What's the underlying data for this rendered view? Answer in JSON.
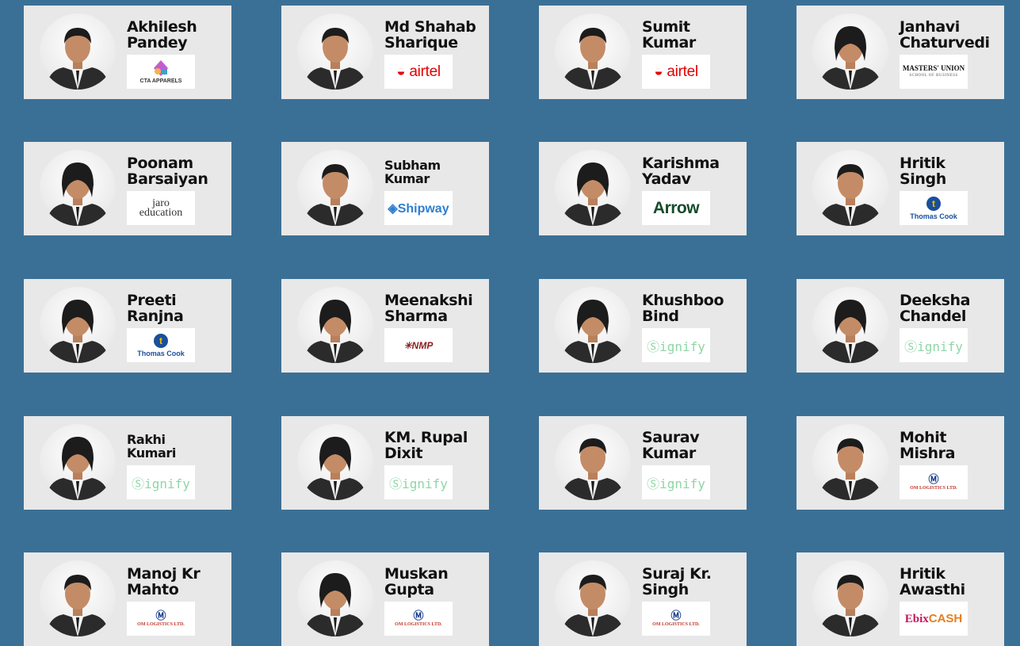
{
  "theme": {
    "background": "#3b7096",
    "card": "#e8e8e8"
  },
  "placements": [
    {
      "name": [
        "Akhilesh",
        "Pandey"
      ],
      "logo": "cta-apparels-logo",
      "logo_text": "CTA APPARELS",
      "gender": "m"
    },
    {
      "name": [
        "Md Shahab",
        "Sharique"
      ],
      "logo": "airtel-logo",
      "logo_text": "airtel",
      "gender": "m"
    },
    {
      "name": [
        "Sumit",
        "Kumar"
      ],
      "logo": "airtel-logo",
      "logo_text": "airtel",
      "gender": "m"
    },
    {
      "name": [
        "Janhavi",
        "Chaturvedi"
      ],
      "logo": "masters-union-logo",
      "logo_text": "MASTERS' UNION",
      "logo_sub": "SCHOOL OF BUSINESS",
      "gender": "f"
    },
    {
      "name": [
        "Poonam",
        "Barsaiyan"
      ],
      "logo": "jaro-education-logo",
      "logo_text": "jaro",
      "logo_sub": "education",
      "gender": "f"
    },
    {
      "name": [
        "Subham",
        "Kumar"
      ],
      "logo": "shipway-logo",
      "logo_text": "Shipway",
      "gender": "m",
      "small": true
    },
    {
      "name": [
        "Karishma",
        "Yadav"
      ],
      "logo": "arrow-logo",
      "logo_text": "Arrow",
      "gender": "f"
    },
    {
      "name": [
        "Hritik",
        "Singh"
      ],
      "logo": "thomas-cook-logo",
      "logo_text": "Thomas Cook",
      "gender": "m"
    },
    {
      "name": [
        "Preeti",
        "Ranjna"
      ],
      "logo": "thomas-cook-logo",
      "logo_text": "Thomas Cook",
      "gender": "f"
    },
    {
      "name": [
        "Meenakshi",
        "Sharma"
      ],
      "logo": "nmp-logo",
      "logo_text": "NMP",
      "gender": "f"
    },
    {
      "name": [
        "Khushboo",
        "Bind"
      ],
      "logo": "signify-logo",
      "logo_text": "Signify",
      "gender": "f"
    },
    {
      "name": [
        "Deeksha",
        "Chandel"
      ],
      "logo": "signify-logo",
      "logo_text": "Signify",
      "gender": "f"
    },
    {
      "name": [
        "Rakhi",
        "Kumari"
      ],
      "logo": "signify-logo",
      "logo_text": "Signify",
      "gender": "f",
      "small": true
    },
    {
      "name": [
        "KM. Rupal",
        "Dixit"
      ],
      "logo": "signify-logo",
      "logo_text": "Signify",
      "gender": "f"
    },
    {
      "name": [
        "Saurav",
        "Kumar"
      ],
      "logo": "signify-logo",
      "logo_text": "Signify",
      "gender": "m"
    },
    {
      "name": [
        "Mohit",
        "Mishra"
      ],
      "logo": "om-logistics-logo",
      "logo_text": "OM LOGISTICS LTD.",
      "gender": "m"
    },
    {
      "name": [
        "Manoj Kr",
        "Mahto"
      ],
      "logo": "om-logistics-logo",
      "logo_text": "OM LOGISTICS LTD.",
      "gender": "m"
    },
    {
      "name": [
        "Muskan",
        "Gupta"
      ],
      "logo": "om-logistics-logo",
      "logo_text": "OM LOGISTICS LTD.",
      "gender": "f"
    },
    {
      "name": [
        "Suraj Kr.",
        "Singh"
      ],
      "logo": "om-logistics-logo",
      "logo_text": "OM LOGISTICS LTD.",
      "gender": "m"
    },
    {
      "name": [
        "Hritik",
        "Awasthi"
      ],
      "logo": "ebixcash-logo",
      "logo_text": "EbixCASH",
      "gender": "m"
    }
  ]
}
